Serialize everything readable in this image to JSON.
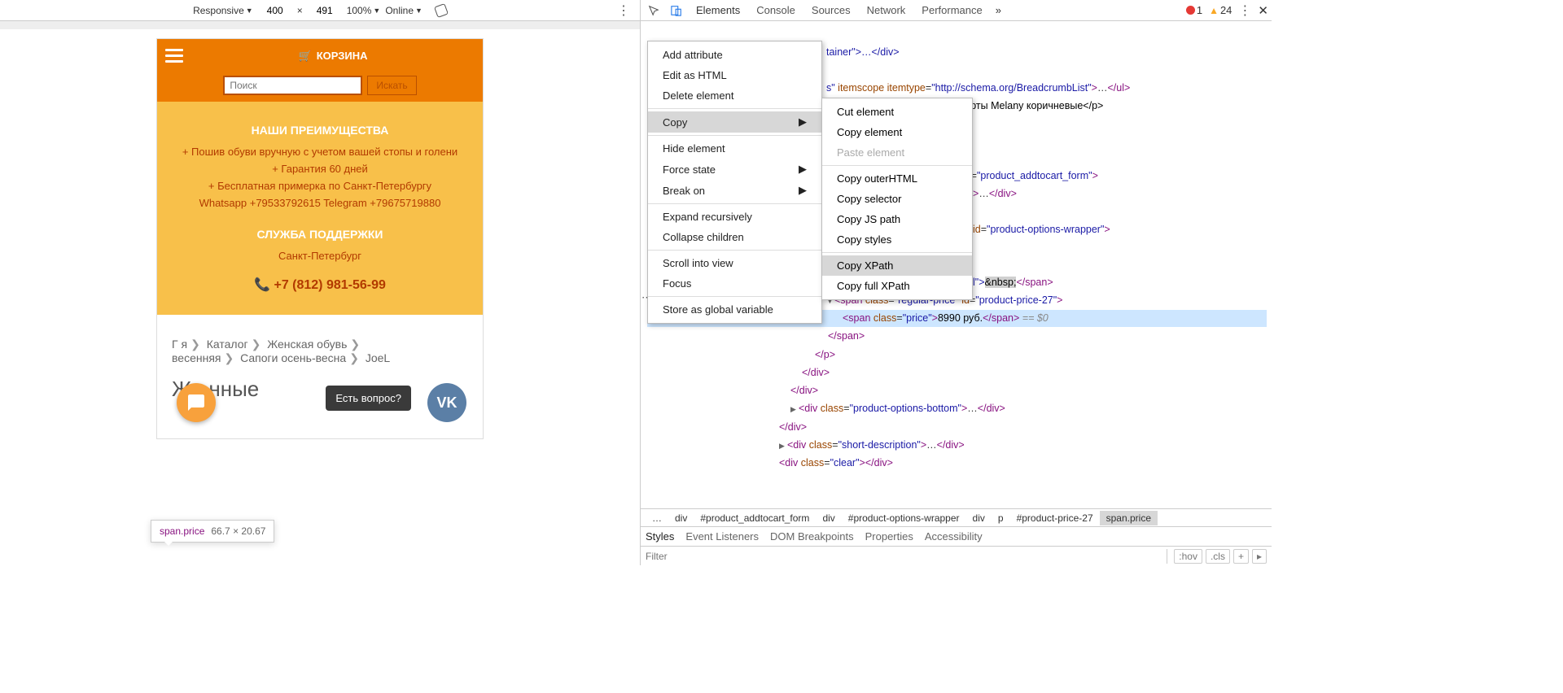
{
  "device_toolbar": {
    "mode": "Responsive",
    "w": "400",
    "x_sep": "×",
    "h": "491",
    "zoom": "100%",
    "network": "Online"
  },
  "site": {
    "cart_label": "КОРЗИНА",
    "search_placeholder": "Поиск",
    "search_btn": "Искать",
    "adv_title": "НАШИ ПРЕИМУЩЕСТВА",
    "adv1": "+ Пошив обуви вручную с учетом вашей стопы и голени",
    "adv2": "+ Гарантия  60 дней",
    "adv3": "+ Бесплатная примерка по Санкт-Петербургу",
    "contacts_line": "Whatsapp +79533792615 Telegram +79675719880",
    "support_title": "СЛУЖБА ПОДДЕРЖКИ",
    "city": "Санкт-Петербург",
    "phone": "+7 (812) 981-56-99",
    "breadcrumbs": [
      "Г         я",
      "Каталог",
      "Женская обувь",
      "          весенняя",
      "Сапоги осень-весна",
      "JoeL"
    ],
    "h1_partial": "Же                     нные",
    "question": "Есть вопрос?",
    "vk": "VK"
  },
  "tooltip": {
    "selector": "span.price",
    "dims": "66.7 × 20.67"
  },
  "devtools": {
    "tabs": [
      "Elements",
      "Console",
      "Sources",
      "Network",
      "Performance"
    ],
    "errors": "1",
    "warnings": "24",
    "context_menu": [
      "Add attribute",
      "Edit as HTML",
      "Delete element",
      "Copy",
      "Hide element",
      "Force state",
      "Break on",
      "Expand recursively",
      "Collapse children",
      "Scroll into view",
      "Focus",
      "Store as global variable"
    ],
    "submenu": [
      "Cut element",
      "Copy element",
      "Paste element",
      "Copy outerHTML",
      "Copy selector",
      "Copy JS path",
      "Copy styles",
      "Copy XPath",
      "Copy full XPath"
    ],
    "dom": {
      "l1": "tainer\">…</div>",
      "l2a": "s\" itemscope itemtype=",
      "l2b": "\"http://schema.org/BreadcrumbList\"",
      "l2c": ">…</ul>",
      "l3": "форты Melany коричневые</p>",
      "form_id": "product_addtocart_form",
      "div_close": "…</div>",
      "pow_id": "product-options-wrapper",
      "nbsp": "&nbsp;",
      "label_txt": "l\">",
      "reg_class": "regular-price",
      "reg_id": "product-price-27",
      "price_class": "price",
      "price_text": "8990 руб.",
      "eq0": "== $0",
      "pob": "product-options-bottom",
      "sd": "short-description",
      "clear": "clear"
    },
    "crumbs": [
      "…",
      "div",
      "#product_addtocart_form",
      "div",
      "#product-options-wrapper",
      "div",
      "p",
      "#product-price-27",
      "span.price"
    ],
    "styles_tabs": [
      "Styles",
      "Event Listeners",
      "DOM Breakpoints",
      "Properties",
      "Accessibility"
    ],
    "filter_ph": "Filter",
    "hov": ":hov",
    "cls": ".cls",
    "plus": "+"
  }
}
